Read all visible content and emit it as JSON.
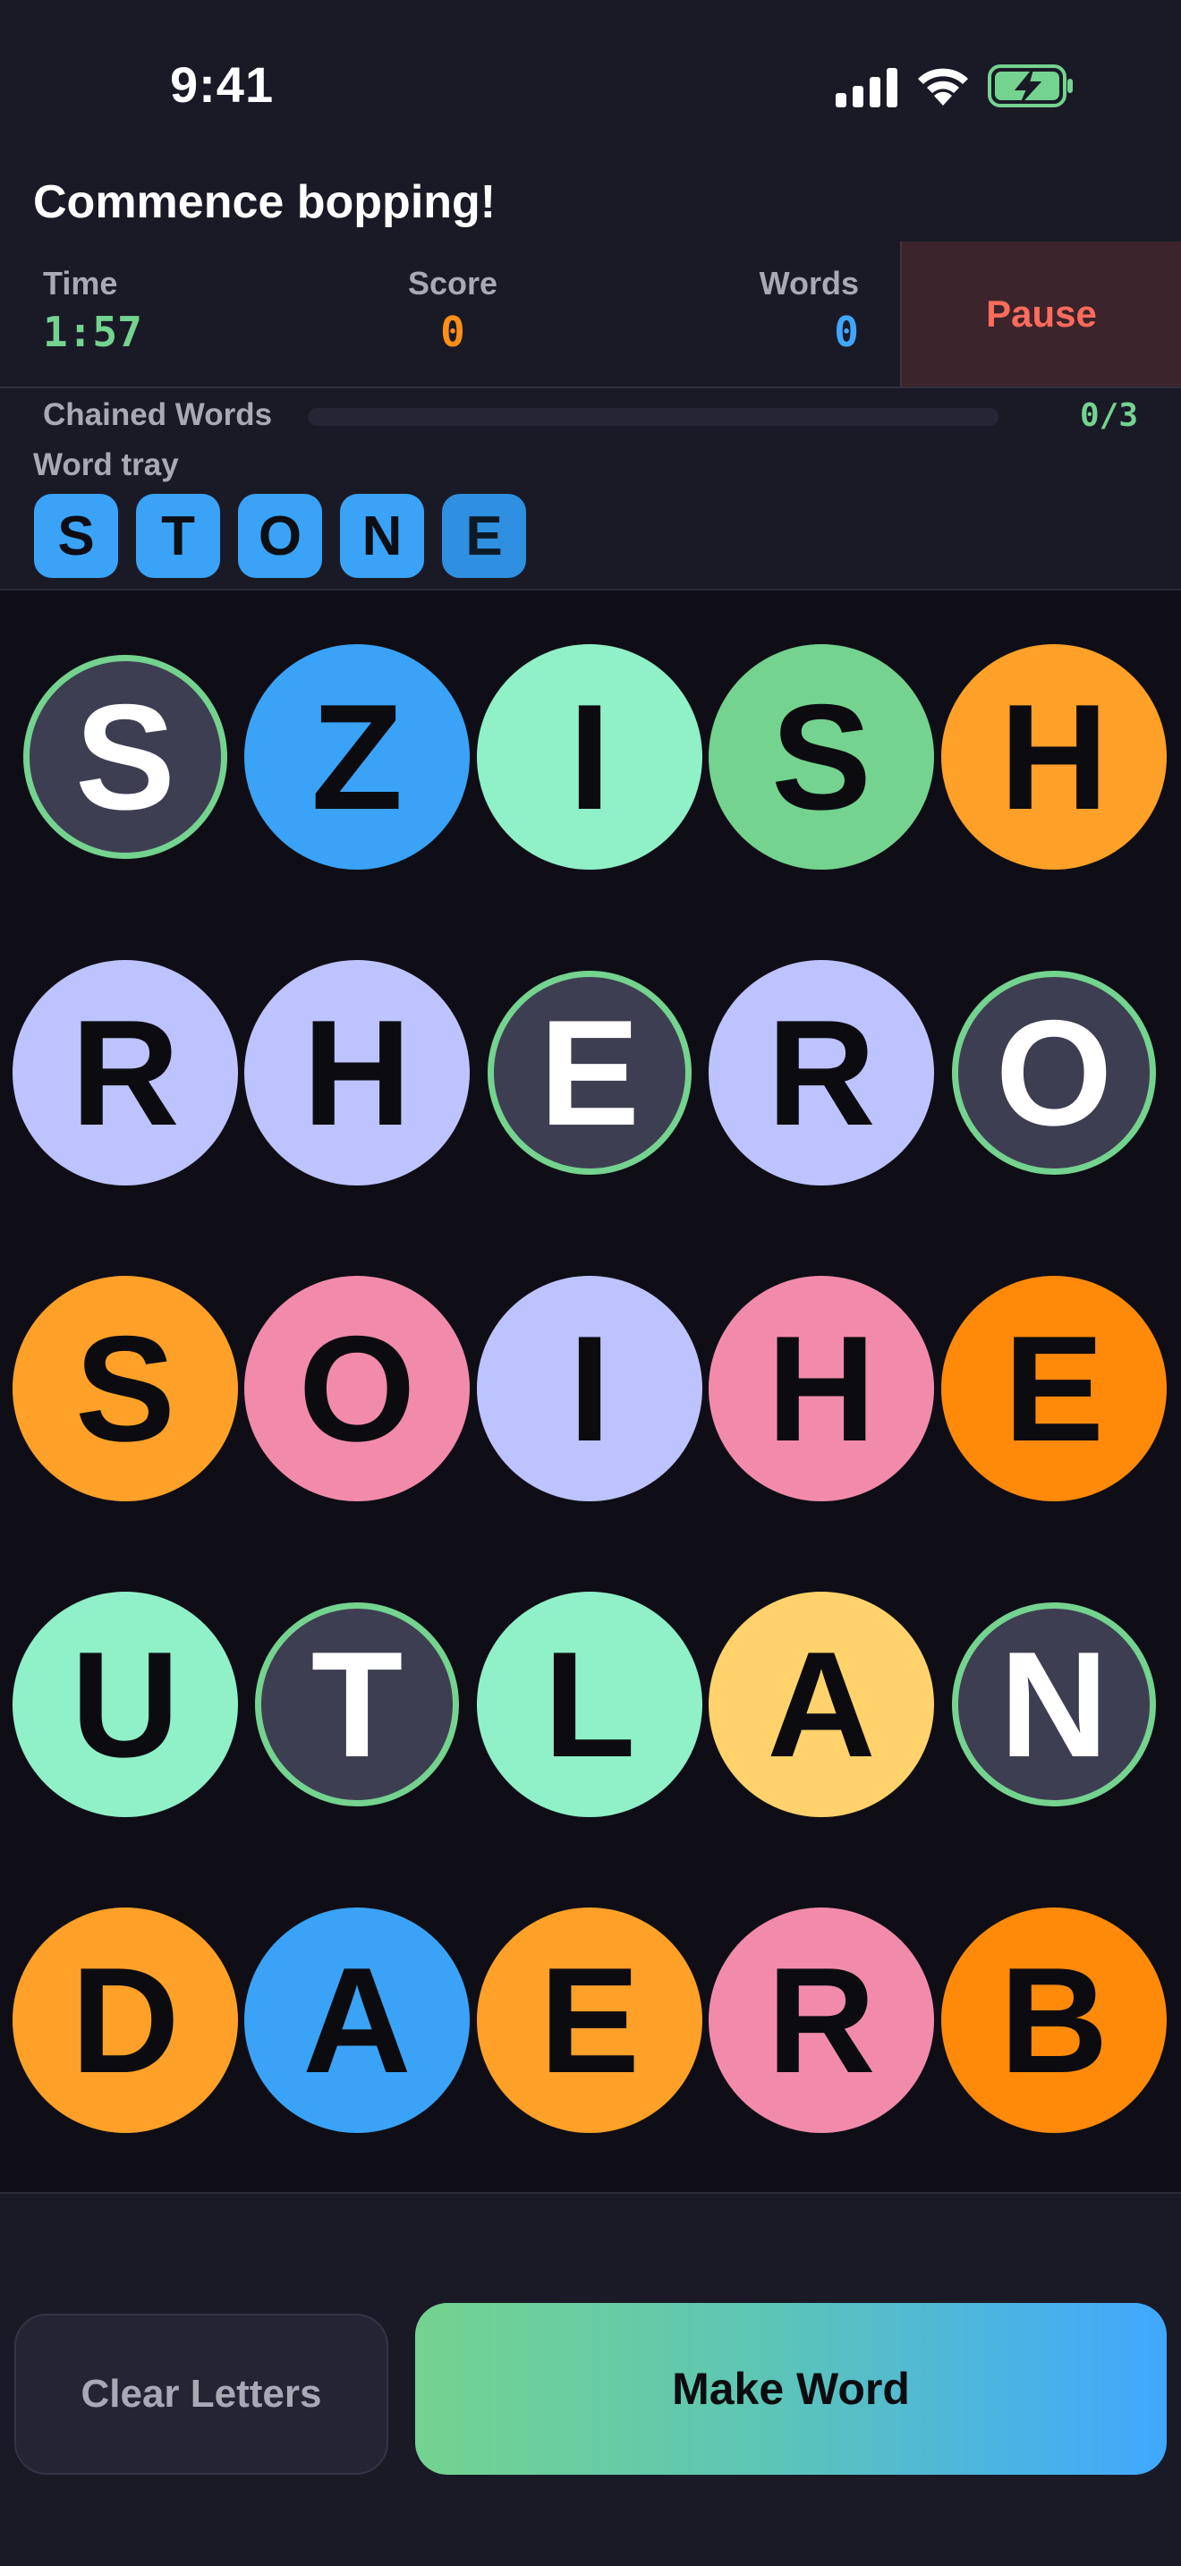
{
  "status_bar": {
    "time": "9:41"
  },
  "header": {
    "title": "Commence bopping!"
  },
  "stats": {
    "time_label": "Time",
    "time_value": "1:57",
    "score_label": "Score",
    "score_value": "0",
    "words_label": "Words",
    "words_value": "0",
    "pause_label": "Pause"
  },
  "chain": {
    "label": "Chained Words",
    "count": "0/3",
    "progress": 0
  },
  "tray": {
    "label": "Word tray",
    "letters": [
      "S",
      "T",
      "O",
      "N",
      "E"
    ]
  },
  "board": {
    "rows": [
      [
        {
          "letter": "S",
          "color": "#3e3e52",
          "selected": true
        },
        {
          "letter": "Z",
          "color": "#3aa3f7",
          "selected": false
        },
        {
          "letter": "I",
          "color": "#90f0c8",
          "selected": false
        },
        {
          "letter": "S",
          "color": "#74d38f",
          "selected": false
        },
        {
          "letter": "H",
          "color": "#ffa128",
          "selected": false
        }
      ],
      [
        {
          "letter": "R",
          "color": "#bcc3ff",
          "selected": false
        },
        {
          "letter": "H",
          "color": "#bcc3ff",
          "selected": false
        },
        {
          "letter": "E",
          "color": "#3e3e52",
          "selected": true
        },
        {
          "letter": "R",
          "color": "#bcc3ff",
          "selected": false
        },
        {
          "letter": "O",
          "color": "#3e3e52",
          "selected": true
        }
      ],
      [
        {
          "letter": "S",
          "color": "#ffa128",
          "selected": false
        },
        {
          "letter": "O",
          "color": "#f28bab",
          "selected": false
        },
        {
          "letter": "I",
          "color": "#bcc3ff",
          "selected": false
        },
        {
          "letter": "H",
          "color": "#f28bab",
          "selected": false
        },
        {
          "letter": "E",
          "color": "#ff8a0a",
          "selected": false
        }
      ],
      [
        {
          "letter": "U",
          "color": "#90f0c8",
          "selected": false
        },
        {
          "letter": "T",
          "color": "#3e3e52",
          "selected": true
        },
        {
          "letter": "L",
          "color": "#90f0c8",
          "selected": false
        },
        {
          "letter": "A",
          "color": "#ffd26b",
          "selected": false
        },
        {
          "letter": "N",
          "color": "#3e3e52",
          "selected": true
        }
      ],
      [
        {
          "letter": "D",
          "color": "#ffa128",
          "selected": false
        },
        {
          "letter": "A",
          "color": "#3aa3f7",
          "selected": false
        },
        {
          "letter": "E",
          "color": "#ffa128",
          "selected": false
        },
        {
          "letter": "R",
          "color": "#f28bab",
          "selected": false
        },
        {
          "letter": "B",
          "color": "#ff8a0a",
          "selected": false
        }
      ]
    ]
  },
  "actions": {
    "clear_label": "Clear Letters",
    "make_label": "Make Word"
  },
  "colors": {
    "accent_green": "#74d38f",
    "accent_orange": "#ff8f16",
    "accent_blue": "#42a6ff",
    "pause_red": "#ff6b5c"
  },
  "icons": {
    "signal": "cellular-signal-icon",
    "wifi": "wifi-icon",
    "battery": "battery-charging-icon"
  }
}
